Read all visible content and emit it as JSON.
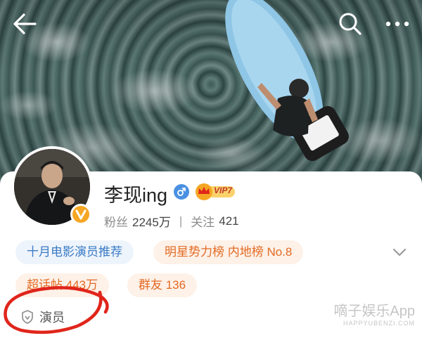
{
  "profile": {
    "name": "李现ing",
    "vip_label": "VIP7",
    "stats": {
      "fans_label": "粉丝",
      "fans_value": "2245万",
      "follow_label": "关注",
      "follow_value": "421"
    }
  },
  "tags": [
    {
      "label": "十月电影演员推荐",
      "style": "blue"
    },
    {
      "label": "明星势力榜 内地榜 No.8",
      "style": "orange"
    },
    {
      "label": "超话帖 443万",
      "style": "orange"
    },
    {
      "label": "群友 136",
      "style": "orange"
    }
  ],
  "role": {
    "label": "演员"
  },
  "watermark": {
    "main": "嘀子娱乐App",
    "sub": "HAPPYUBENZI.COM"
  },
  "icons": {
    "back": "back-arrow-icon",
    "search": "search-icon",
    "more": "more-icon",
    "gender": "male-icon",
    "verified": "verified-badge-icon",
    "expand": "chevron-down-icon",
    "role": "shield-icon"
  },
  "colors": {
    "tag_blue_text": "#3a7bc6",
    "tag_orange_text": "#e46a23",
    "annotation_red": "#e0251b",
    "verified_gold": "#f5a623",
    "gender_blue": "#4a90e2"
  }
}
